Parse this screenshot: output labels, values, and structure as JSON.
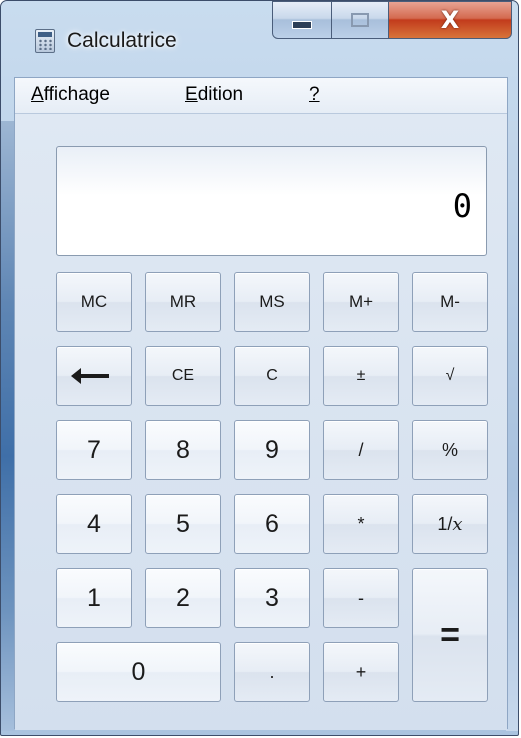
{
  "window": {
    "title": "Calculatrice"
  },
  "caption": {
    "close_glyph": "X"
  },
  "menu": [
    {
      "key": "affichage",
      "mnemonic": "A",
      "rest": "ffichage"
    },
    {
      "key": "edition",
      "mnemonic": "E",
      "rest": "dition"
    },
    {
      "key": "help",
      "mnemonic": "?",
      "rest": ""
    }
  ],
  "display": {
    "value": "0"
  },
  "keys": {
    "mc": "MC",
    "mr": "MR",
    "ms": "MS",
    "mplus": "M+",
    "mminus": "M-",
    "ce": "CE",
    "c": "C",
    "plusminus": "±",
    "sqrt": "√",
    "d7": "7",
    "d8": "8",
    "d9": "9",
    "divide": "/",
    "percent": "%",
    "d4": "4",
    "d5": "5",
    "d6": "6",
    "multiply": "*",
    "reciprocal_prefix": "1/",
    "reciprocal_var": "x",
    "d1": "1",
    "d2": "2",
    "d3": "3",
    "minus": "-",
    "equals": "=",
    "d0": "0",
    "decimal": ".",
    "plus": "+"
  },
  "icons": {
    "app": "calculator-icon",
    "backspace": "back-arrow-icon"
  }
}
